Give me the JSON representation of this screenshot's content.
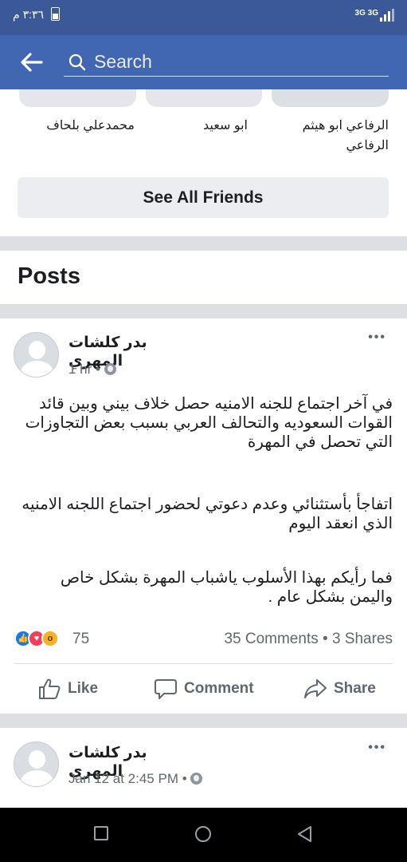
{
  "status": {
    "time": "٣:٣٦ م",
    "network": "3G 3G",
    "sim": "1"
  },
  "search": {
    "placeholder": "Search"
  },
  "friends": {
    "names": [
      "الرفاعي ابو هيثم الرفاعي",
      "ابو سعيد",
      "محمدعلي بلحاف"
    ],
    "see_all_label": "See All Friends"
  },
  "posts_section": {
    "title": "Posts"
  },
  "posts": [
    {
      "author": "بدر كلشات المهري",
      "time": "1 hr",
      "paragraphs": [
        "في آخر اجتماع للجنه الامنيه حصل خلاف بيني وبين قائد القوات السعوديه والتحالف العربي بسبب بعض التجاوزات التي تحصل في المهرة",
        "اتفاجأ  بأستثنائي وعدم دعوتي لحضور اجتماع اللجنه الامنيه الذي انعقد اليوم",
        "فما رأيكم بهذا الأسلوب ياشباب المهرة بشكل خاص واليمن بشكل عام  ."
      ],
      "reaction_count": "75",
      "comments": "35 Comments",
      "shares": "3 Shares",
      "actions": {
        "like": "Like",
        "comment": "Comment",
        "share": "Share"
      }
    },
    {
      "author": "بدر كلشات المهري",
      "time": "Jan 12 at 2:45 PM"
    }
  ],
  "icons": {
    "back": "back-arrow-icon",
    "search": "search-icon",
    "more": "more-options-icon",
    "globe": "public-globe-icon",
    "like": "like-thumb-icon",
    "comment": "comment-bubble-icon",
    "share": "share-arrow-icon"
  },
  "colors": {
    "brand": "#4267b2",
    "status_bar": "#3b5998",
    "like_blue": "#1877f2",
    "love_red": "#f33e58",
    "wow_yellow": "#f7b125"
  }
}
